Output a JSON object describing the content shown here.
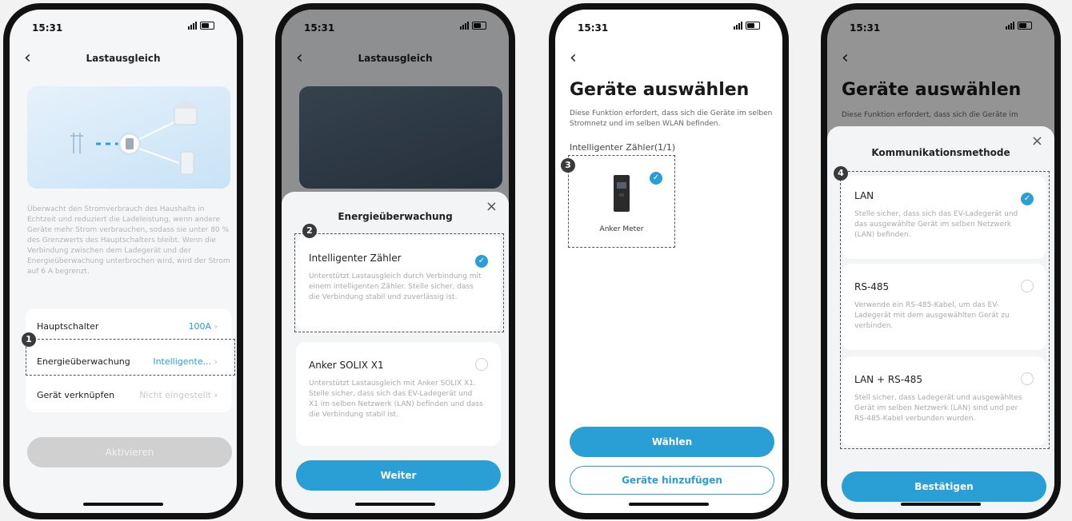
{
  "colors": {
    "accent": "#2a9fd6",
    "background": "#f2f2f2",
    "phone_frame": "#111111",
    "muted_text": "#aaaaaa",
    "disabled_button": "#d0d0d0"
  },
  "status_bar": {
    "time": "15:31"
  },
  "screen1": {
    "title": "Lastausgleich",
    "description": "Überwacht den Stromverbrauch des Haushalts in Echtzeit und reduziert die Ladeleistung, wenn andere Geräte mehr Strom verbrauchen, sodass sie unter 80 % des Grenzwerts des Hauptschalters bleibt. Wenn die Verbindung zwischen dem Ladegerät und der Energieüberwachung unterbrochen wird, wird der Strom auf 6 A begrenzt.",
    "rows": [
      {
        "label": "Hauptschalter",
        "value": "100A"
      },
      {
        "label": "Energieüberwachung",
        "value": "Intelligente..."
      },
      {
        "label": "Gerät verknüpfen",
        "value": "Nicht eingestellt"
      }
    ],
    "button": "Aktivieren",
    "marker": "1"
  },
  "screen2": {
    "title": "Lastausgleich",
    "sheet_title": "Energieüberwachung",
    "options": [
      {
        "title": "Intelligenter Zähler",
        "desc": "Unterstützt Lastausgleich durch Verbindung mit einem intelligenten Zähler. Stelle sicher, dass die Verbindung stabil und zuverlässig ist.",
        "selected": true
      },
      {
        "title": "Anker SOLIX X1",
        "desc": "Unterstützt Lastausgleich mit Anker SOLIX X1. Stelle sicher, dass sich das EV-Ladegerät und X1 im selben Netzwerk (LAN) befinden und dass die Verbindung stabil ist.",
        "selected": false
      }
    ],
    "button": "Weiter",
    "marker": "2"
  },
  "screen3": {
    "title": "Geräte auswählen",
    "description": "Diese Funktion erfordert, dass sich die Geräte im selben Stromnetz und im selben WLAN befinden.",
    "section_label": "Intelligenter Zähler(1/1)",
    "device_name": "Anker Meter",
    "primary_button": "Wählen",
    "secondary_button": "Geräte hinzufügen",
    "marker": "3"
  },
  "screen4": {
    "title": "Geräte auswählen",
    "description_partial": "Diese Funktion erfordert, dass sich die Geräte im",
    "sheet_title": "Kommunikationsmethode",
    "options": [
      {
        "title": "LAN",
        "desc": "Stelle sicher, dass sich das EV-Ladegerät und das ausgewählte Gerät im selben Netzwerk (LAN) befinden.",
        "selected": true
      },
      {
        "title": "RS-485",
        "desc": "Verwende ein RS-485-Kabel, um das EV-Ladegerät mit dem ausgewählten Gerät zu verbinden.",
        "selected": false
      },
      {
        "title": "LAN + RS-485",
        "desc": "Stell sicher, dass Ladegerät und ausgewähltes Gerät im selben Netzwerk (LAN) sind und per RS-485-Kabel verbunden wurden.",
        "selected": false
      }
    ],
    "button": "Bestätigen",
    "marker": "4"
  }
}
